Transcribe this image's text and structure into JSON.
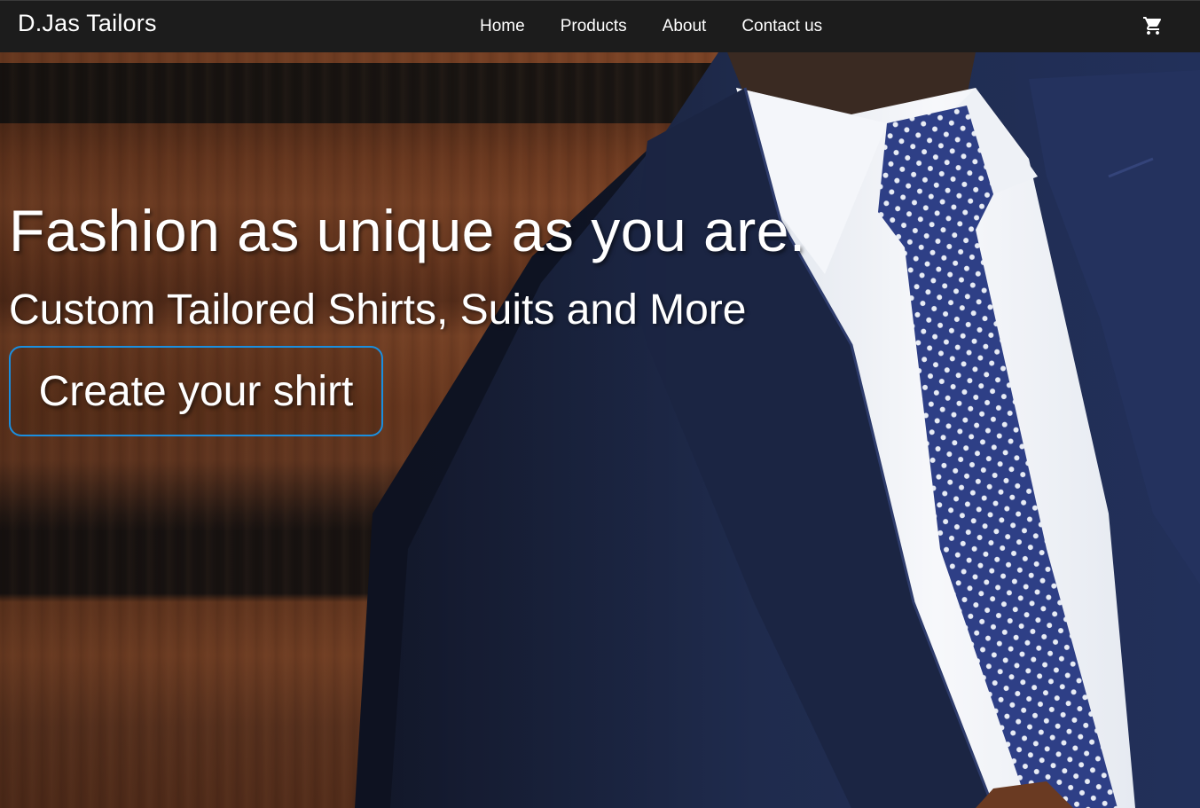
{
  "header": {
    "brand": "D.Jas Tailors",
    "nav": [
      "Home",
      "Products",
      "About",
      "Contact us"
    ],
    "cart_icon": "shopping-cart-icon"
  },
  "hero": {
    "title": "Fashion as unique as you are.",
    "subtitle": "Custom Tailored Shirts, Suits and More",
    "cta_label": "Create your shirt",
    "image": "man-in-navy-suit-with-polka-dot-tie"
  },
  "colors": {
    "navbar": "#1c1c1c",
    "cta_border": "#1a8fe0",
    "suit": "#1f2a4a",
    "tie": "#2e3f86"
  }
}
